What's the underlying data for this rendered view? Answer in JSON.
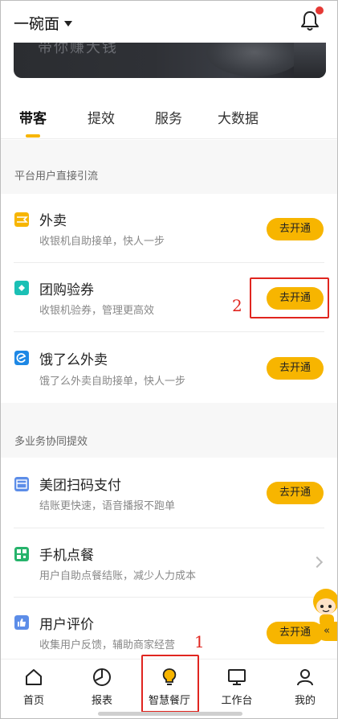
{
  "header": {
    "store_name": "一碗面"
  },
  "banner": {
    "text": "带你赚大钱"
  },
  "tabs": [
    {
      "label": "带客",
      "active": true
    },
    {
      "label": "提效",
      "active": false
    },
    {
      "label": "服务",
      "active": false
    },
    {
      "label": "大数据",
      "active": false
    }
  ],
  "sections": [
    {
      "title": "平台用户直接引流"
    },
    {
      "title": "多业务协同提效"
    }
  ],
  "rows": [
    {
      "title": "外卖",
      "subtitle": "收银机自助接单，快人一步",
      "action": "去开通",
      "icon": "takeout-icon",
      "icon_color": "#f7b500"
    },
    {
      "title": "团购验券",
      "subtitle": "收银机验券，管理更高效",
      "action": "去开通",
      "icon": "coupon-icon",
      "icon_color": "#1bc0b5"
    },
    {
      "title": "饿了么外卖",
      "subtitle": "饿了么外卖自助接单，快人一步",
      "action": "去开通",
      "icon": "eleme-icon",
      "icon_color": "#1e88e5"
    },
    {
      "title": "美团扫码支付",
      "subtitle": "结账更快速，语音播报不跑单",
      "action": "去开通",
      "icon": "scan-pay-icon",
      "icon_color": "#5c8de8"
    },
    {
      "title": "手机点餐",
      "subtitle": "用户自助点餐结账，减少人力成本",
      "action": "",
      "icon": "qr-order-icon",
      "icon_color": "#26b36b"
    },
    {
      "title": "用户评价",
      "subtitle": "收集用户反馈，辅助商家经营",
      "action": "去开通",
      "icon": "thumbs-up-icon",
      "icon_color": "#5c8de8"
    }
  ],
  "annotations": {
    "one": "1",
    "two": "2"
  },
  "mascot": {
    "collapse_glyph": "«"
  },
  "bottom_nav": [
    {
      "label": "首页",
      "icon": "home-icon"
    },
    {
      "label": "报表",
      "icon": "report-icon"
    },
    {
      "label": "智慧餐厅",
      "icon": "bulb-icon",
      "color": "#f7b500"
    },
    {
      "label": "工作台",
      "icon": "monitor-icon"
    },
    {
      "label": "我的",
      "icon": "user-icon"
    }
  ],
  "colors": {
    "accent": "#f7b500",
    "annotation": "#e0251f"
  }
}
